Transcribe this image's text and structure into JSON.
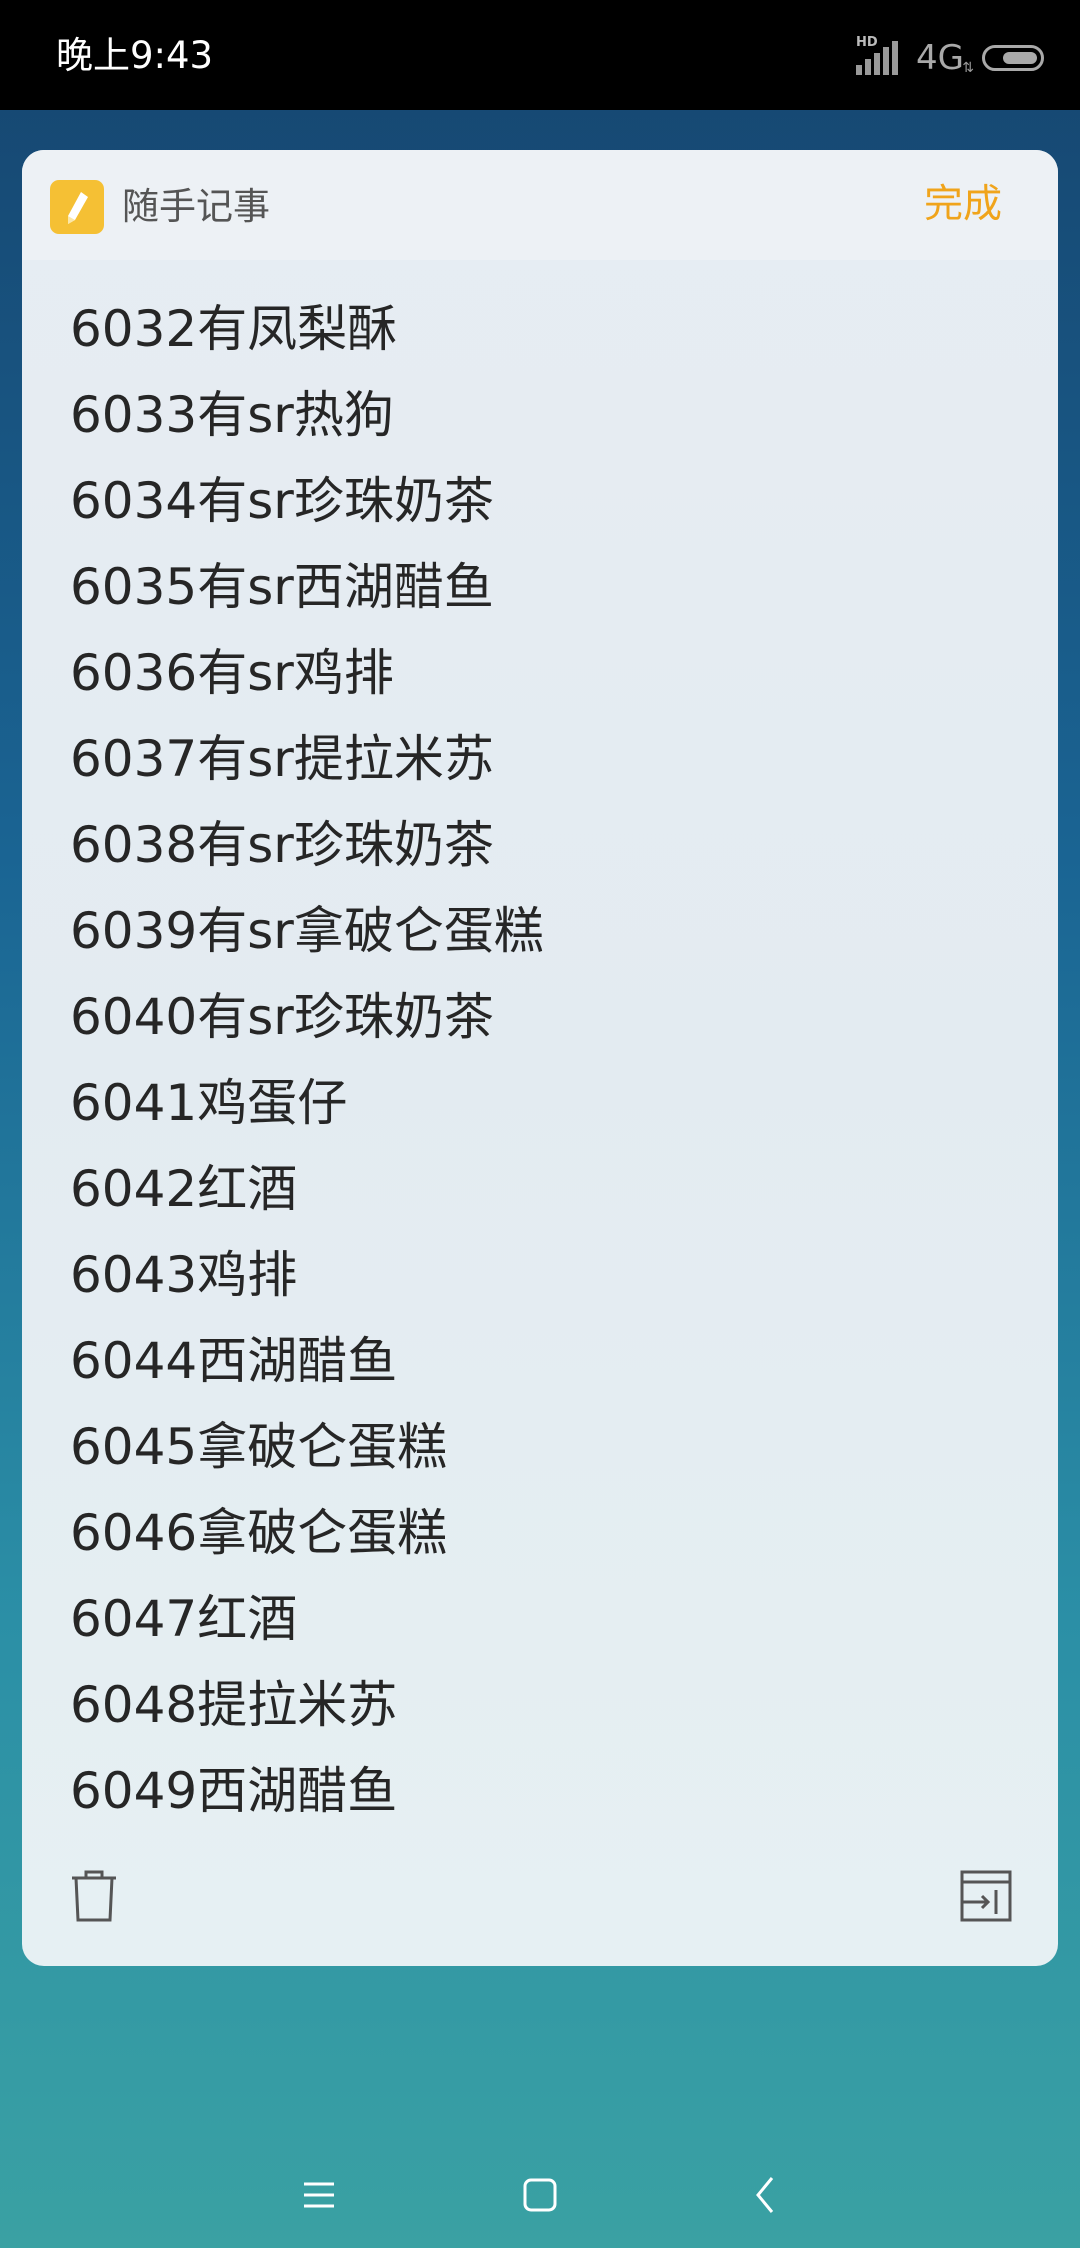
{
  "status_bar": {
    "time": "晚上9:43",
    "hd_label": "HD",
    "network": "4G",
    "battery_level": 0.7,
    "icons": [
      "signal-icon",
      "battery-icon"
    ]
  },
  "note": {
    "app_title": "随手记事",
    "done_label": "完成",
    "accent_color": "#f0a41b",
    "icon_color": "#f5c034",
    "lines": [
      "6032有凤梨酥",
      "6033有sr热狗",
      "6034有sr珍珠奶茶",
      "6035有sr西湖醋鱼",
      "6036有sr鸡排",
      "6037有sr提拉米苏",
      "6038有sr珍珠奶茶",
      "6039有sr拿破仑蛋糕",
      "6040有sr珍珠奶茶",
      "6041鸡蛋仔",
      "6042红酒",
      "6043鸡排",
      "6044西湖醋鱼",
      "6045拿破仑蛋糕",
      "6046拿破仑蛋糕",
      "6047红酒",
      "6048提拉米苏",
      "6049西湖醋鱼"
    ],
    "toolbar_icons": [
      "trash-icon",
      "export-icon"
    ]
  },
  "nav_bar": {
    "icons": [
      "menu-icon",
      "home-icon",
      "back-icon"
    ]
  }
}
